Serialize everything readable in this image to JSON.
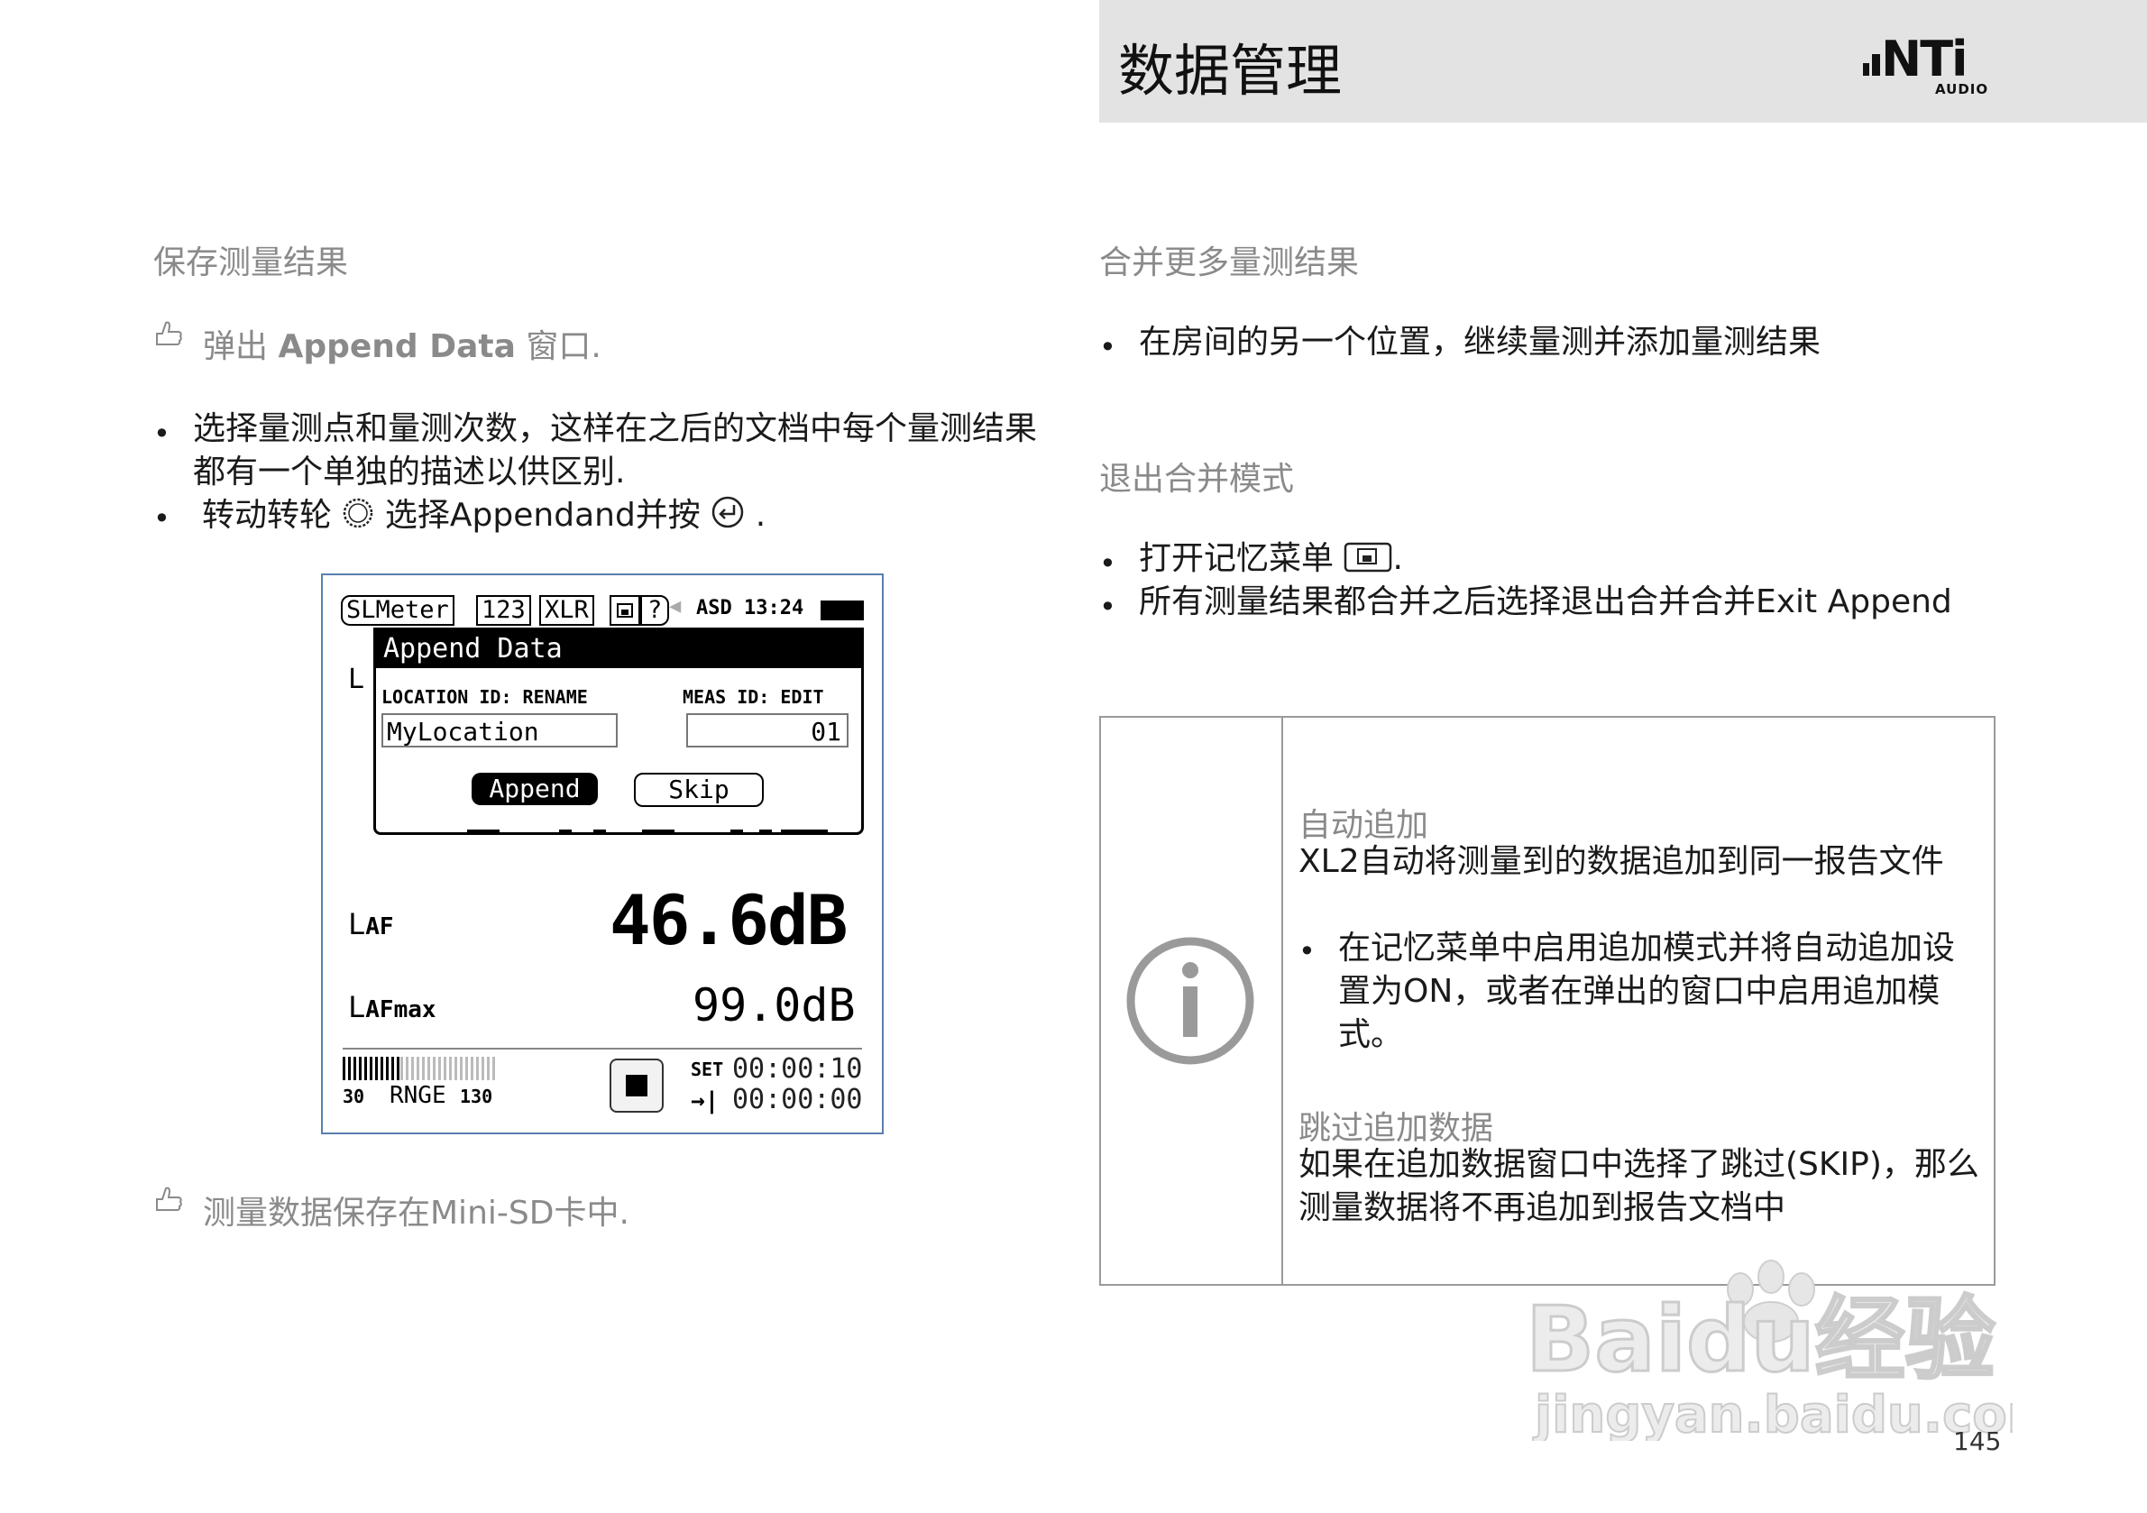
{
  "header": {
    "title": "数据管理",
    "brand": "NTi",
    "brand_sub": "AUDIO"
  },
  "left": {
    "heading": "保存测量结果",
    "tip_prefix": "弹出",
    "tip_bold": "Append Data",
    "tip_suffix": "窗口.",
    "bullets": [
      {
        "line1": "选择量测点和量测次数，这样在之后的文档中每个量测结果",
        "line2": "都有一个单独的描述以供区别."
      },
      {
        "part1": "转动转轮",
        "part2": "选择Appendand并按",
        "part3": "."
      }
    ],
    "footer_tip": "测量数据保存在Mini-SD卡中."
  },
  "device": {
    "tabs": [
      "SLMeter",
      "123",
      "XLR"
    ],
    "status": "ASD 13:24",
    "dialog_title": "Append Data",
    "location_label": "LOCATION ID: RENAME",
    "meas_label": "MEAS ID: EDIT",
    "location_value": "MyLocation",
    "meas_value": "01",
    "append_button": "Append",
    "skip_button": "Skip",
    "laf_label": "L",
    "laf_sub": "AF",
    "laf_value": "46.6dB",
    "lafmax_sub": "AFmax",
    "lafmax_value": "99.0dB",
    "range_low": "30",
    "range_label": "RNGE",
    "range_high": "130",
    "set_label": "SET",
    "set_time": "00:00:10",
    "elapsed_time": "00:00:00"
  },
  "right": {
    "heading1": "合并更多量测结果",
    "bullet1": "在房间的另一个位置，继续量测并添加量测结果",
    "heading2": "退出合并模式",
    "bullet2_prefix": "打开记忆菜单",
    "bullet2_suffix": ".",
    "bullet3": "所有测量结果都合并之后选择退出合并合并Exit Append"
  },
  "info": {
    "title1": "自动追加",
    "text1": "XL2自动将测量到的数据追加到同一报告文件",
    "bullet": [
      "在记忆菜单中启用追加模式并将自动追加设",
      "置为ON，或者在弹出的窗口中启用追加模",
      "式。"
    ],
    "title2": "跳过追加数据",
    "text2": [
      "如果在追加数据窗口中选择了跳过(SKIP)，那么",
      "测量数据将不再追加到报告文档中"
    ]
  },
  "page_number": "145",
  "watermark": {
    "line1": "Baidu经验",
    "line2": "jingyan.baidu.com"
  }
}
